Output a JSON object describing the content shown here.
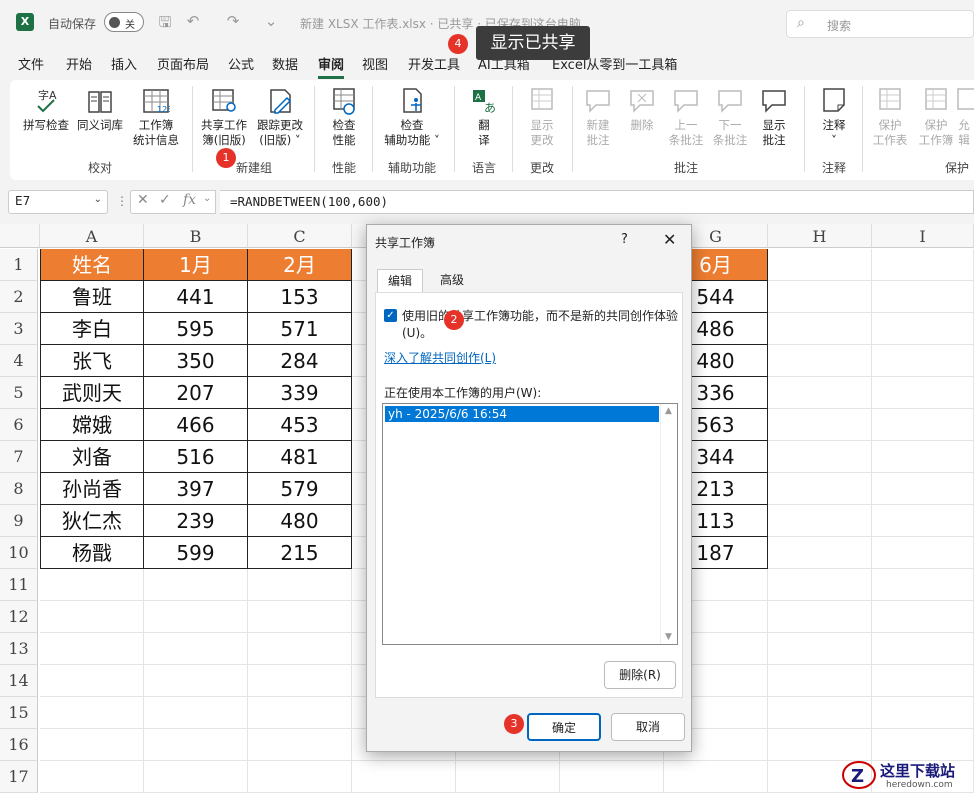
{
  "titlebar": {
    "autosave_label": "自动保存",
    "toggle_state": "关",
    "document_title": "新建 XLSX 工作表.xlsx  ·  已共享 · 已保存到这台电脑",
    "search_placeholder": "搜索"
  },
  "tooltip": "显示已共享",
  "menu": [
    "文件",
    "开始",
    "插入",
    "页面布局",
    "公式",
    "数据",
    "审阅",
    "视图",
    "开发工具",
    "AI工具箱",
    "Excel从零到一工具箱"
  ],
  "menu_active": "审阅",
  "ribbon": {
    "buttons": [
      {
        "label": "拼写检查",
        "enabled": true
      },
      {
        "label": "同义词库",
        "enabled": true
      },
      {
        "label": "工作簿\n统计信息",
        "enabled": true
      },
      {
        "label": "共享工作\n簿(旧版)",
        "enabled": true
      },
      {
        "label": "跟踪更改\n(旧版) ˅",
        "enabled": true
      },
      {
        "label": "检查\n性能",
        "enabled": true
      },
      {
        "label": "检查\n辅助功能 ˅",
        "enabled": true
      },
      {
        "label": "翻\n译",
        "enabled": true
      },
      {
        "label": "显示\n更改",
        "enabled": false
      },
      {
        "label": "新建\n批注",
        "enabled": false
      },
      {
        "label": "删除",
        "enabled": false
      },
      {
        "label": "上一\n条批注",
        "enabled": false
      },
      {
        "label": "下一\n条批注",
        "enabled": false
      },
      {
        "label": "显示\n批注",
        "enabled": true
      },
      {
        "label": "注释\n˅",
        "enabled": true
      },
      {
        "label": "保护\n工作表",
        "enabled": false
      },
      {
        "label": "保护\n工作簿",
        "enabled": false
      },
      {
        "label": "允\n辑",
        "enabled": false
      }
    ],
    "groups": [
      "校对",
      "新建组",
      "性能",
      "辅助功能",
      "语言",
      "更改",
      "批注",
      "注释",
      "保护"
    ]
  },
  "formula_bar": {
    "name_box": "E7",
    "formula": "=RANDBETWEEN(100,600)"
  },
  "sheet": {
    "columns": [
      "A",
      "B",
      "C",
      "D",
      "E",
      "F",
      "G",
      "H",
      "I"
    ],
    "rows": [
      "1",
      "2",
      "3",
      "4",
      "5",
      "6",
      "7",
      "8",
      "9",
      "10",
      "11",
      "12",
      "13",
      "14",
      "15",
      "16",
      "17"
    ],
    "header": [
      "姓名",
      "1月",
      "2月",
      "6月"
    ],
    "data": [
      [
        "鲁班",
        "441",
        "153",
        "544"
      ],
      [
        "李白",
        "595",
        "571",
        "486"
      ],
      [
        "张飞",
        "350",
        "284",
        "480"
      ],
      [
        "武则天",
        "207",
        "339",
        "336"
      ],
      [
        "嫦娥",
        "466",
        "453",
        "563"
      ],
      [
        "刘备",
        "516",
        "481",
        "344"
      ],
      [
        "孙尚香",
        "397",
        "579",
        "213"
      ],
      [
        "狄仁杰",
        "239",
        "480",
        "113"
      ],
      [
        "杨戬",
        "599",
        "215",
        "187"
      ]
    ]
  },
  "dialog": {
    "title": "共享工作簿",
    "help": "?",
    "close": "✕",
    "tabs": [
      "编辑",
      "高级"
    ],
    "checkbox_label": "使用旧的共享工作簿功能，而不是新的共同创作体验(U)。",
    "checkbox_checked": true,
    "link": "深入了解共同创作(L)",
    "users_label": "正在使用本工作簿的用户(W):",
    "users": [
      "yh - 2025/6/6 16:54"
    ],
    "delete_button": "删除(R)",
    "ok_button": "确定",
    "cancel_button": "取消"
  },
  "badges": [
    "1",
    "2",
    "3",
    "4"
  ],
  "watermark": {
    "big": "这里下载站",
    "small": "heredown.com"
  },
  "colors": {
    "accent": "#1e7145",
    "header_fill": "#ed7d31",
    "badge": "#e6332a",
    "selection": "#0078d7"
  }
}
